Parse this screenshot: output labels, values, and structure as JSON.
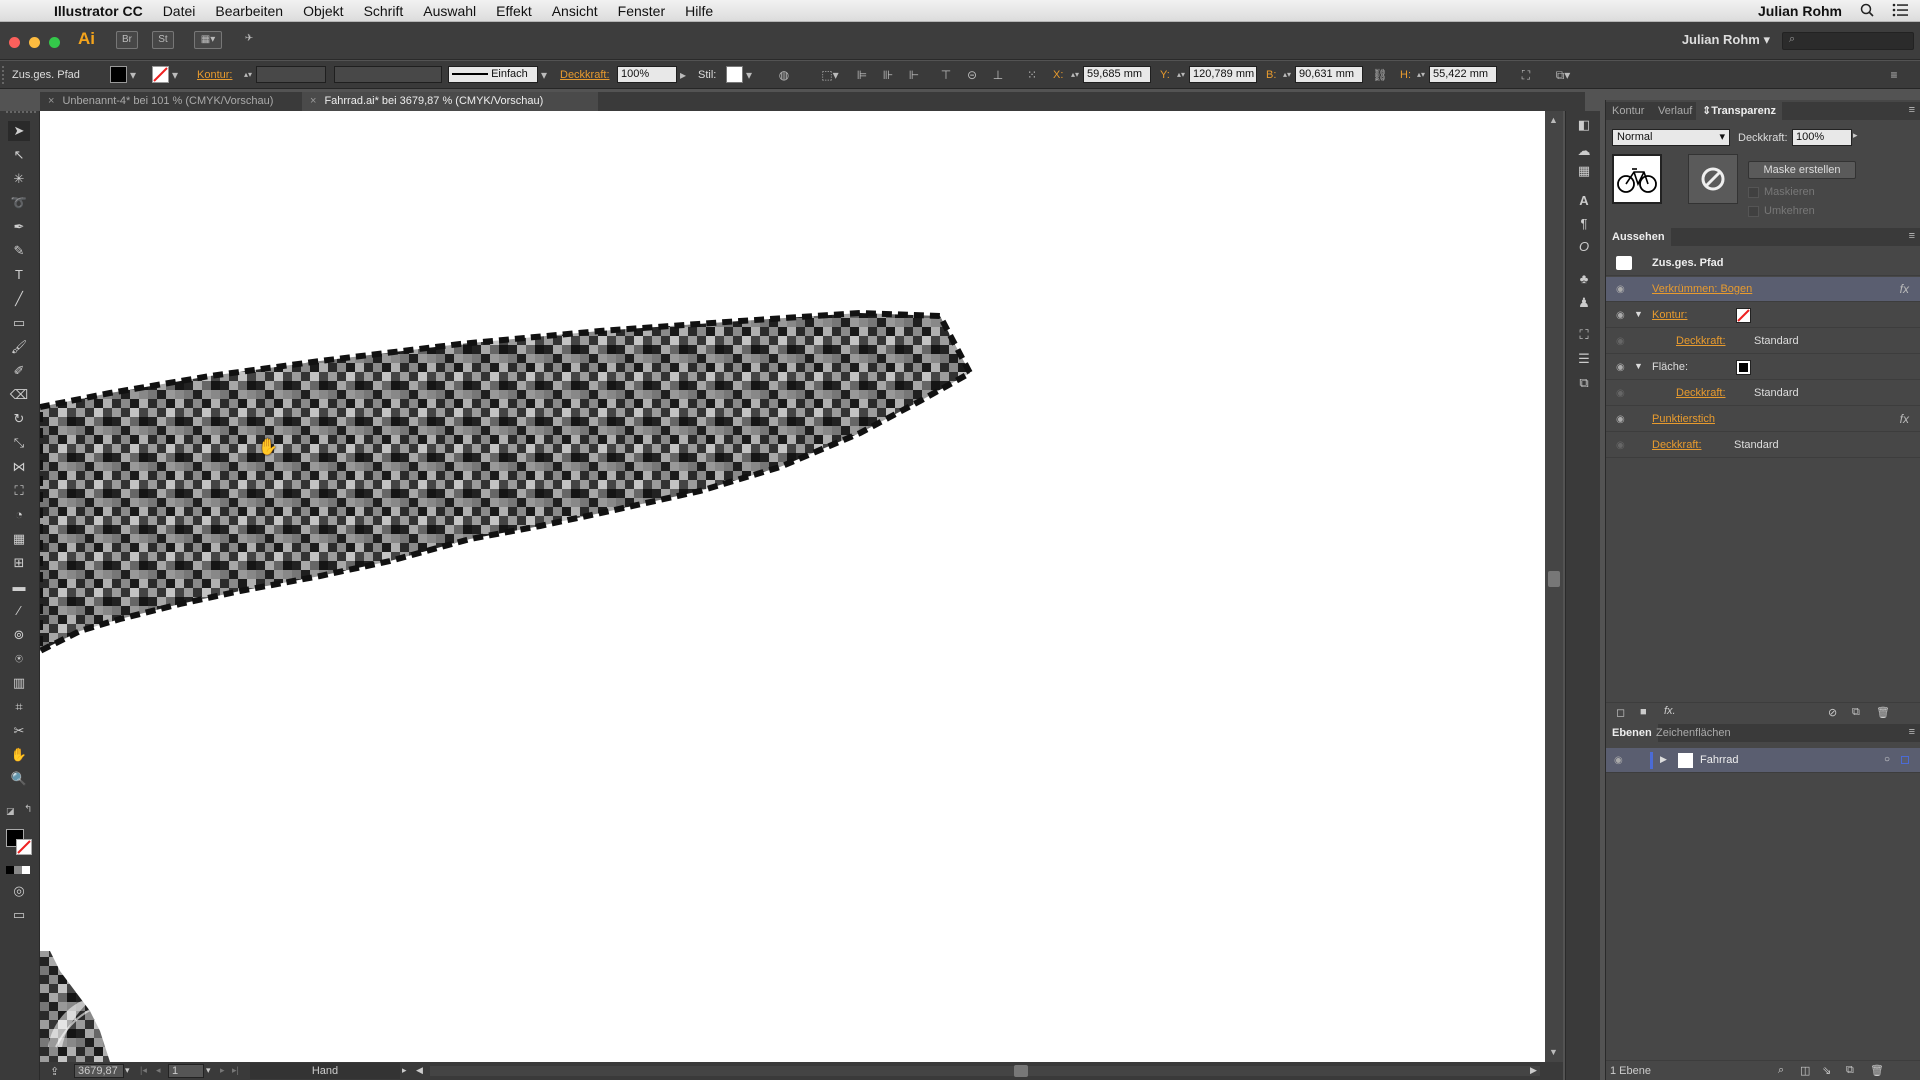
{
  "menubar": {
    "app_name": "Illustrator CC",
    "items": [
      "Datei",
      "Bearbeiten",
      "Objekt",
      "Schrift",
      "Auswahl",
      "Effekt",
      "Ansicht",
      "Fenster",
      "Hilfe"
    ],
    "user": "Julian Rohm"
  },
  "appbar": {
    "logo": "Ai",
    "bridge": "Br",
    "stock": "St",
    "workspace": "Julian Rohm"
  },
  "control": {
    "object_type": "Zus.ges. Pfad",
    "kontur_label": "Kontur:",
    "stroke_style": "Einfach",
    "deckkraft_label": "Deckkraft:",
    "deckkraft_value": "100%",
    "stil_label": "Stil:",
    "x_label": "X:",
    "x_value": "59,685 mm",
    "y_label": "Y:",
    "y_value": "120,789 mm",
    "b_label": "B:",
    "b_value": "90,631 mm",
    "h_label": "H:",
    "h_value": "55,422 mm"
  },
  "tabs": [
    {
      "label": "Unbenannt-4* bei 101 % (CMYK/Vorschau)",
      "active": false
    },
    {
      "label": "Fahrrad.ai* bei 3679,87 % (CMYK/Vorschau)",
      "active": true
    }
  ],
  "statusbar": {
    "zoom": "3679,87",
    "artboard": "1",
    "tool": "Hand"
  },
  "transparency_panel": {
    "tabs": [
      "Kontur",
      "Verlauf",
      "Transparenz"
    ],
    "blend_mode": "Normal",
    "deckkraft_label": "Deckkraft:",
    "deckkraft_value": "100%",
    "mask_button": "Maske erstellen",
    "maskieren": "Maskieren",
    "umkehren": "Umkehren"
  },
  "appearance_panel": {
    "title": "Aussehen",
    "object": "Zus.ges. Pfad",
    "rows": [
      {
        "label": "Verkrümmen: Bogen",
        "kind": "effect",
        "fx": true,
        "selected": true
      },
      {
        "label": "Kontur:",
        "kind": "stroke"
      },
      {
        "label": "Deckkraft:",
        "value": "Standard",
        "kind": "sub"
      },
      {
        "label": "Fläche:",
        "kind": "fill"
      },
      {
        "label": "Deckkraft:",
        "value": "Standard",
        "kind": "sub"
      },
      {
        "label": "Punktierstich",
        "kind": "effect",
        "fx": true
      },
      {
        "label": "Deckkraft:",
        "value": "Standard",
        "kind": "opacity"
      }
    ]
  },
  "layers_panel": {
    "tabs": [
      "Ebenen",
      "Zeichenflächen"
    ],
    "layer_name": "Fahrrad",
    "count": "1 Ebene"
  },
  "colors": {
    "accent_orange": "#e89b2e",
    "selection": "#5a5e70",
    "layer_blue": "#4b6bd6"
  }
}
